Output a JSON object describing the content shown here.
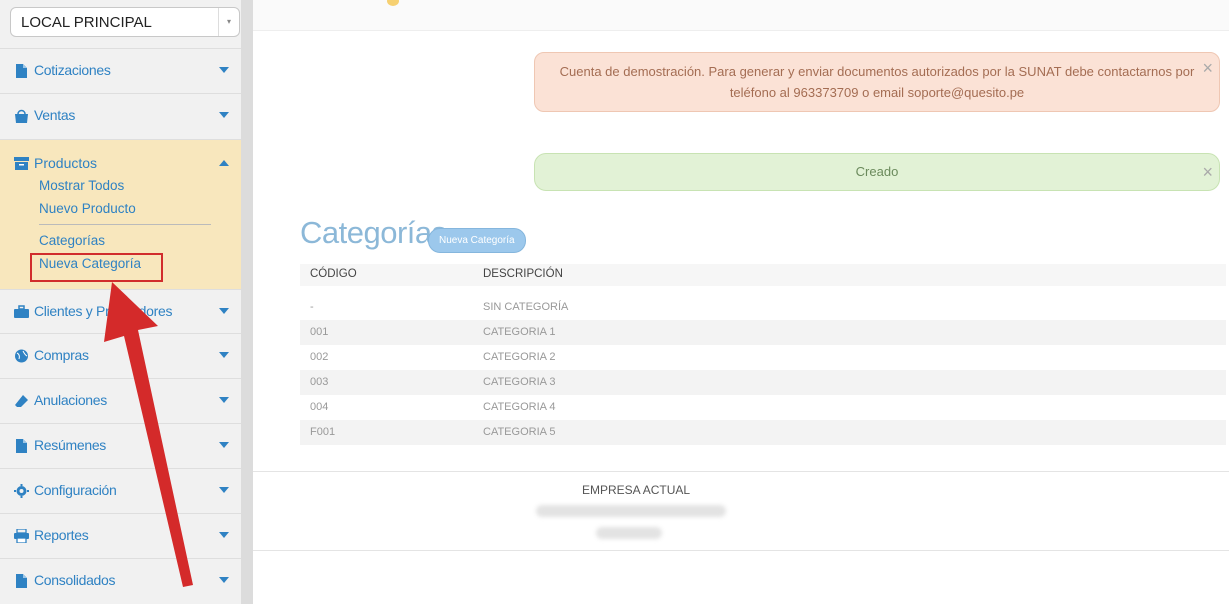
{
  "location_select": {
    "value": "LOCAL PRINCIPAL"
  },
  "sidebar": {
    "items": [
      {
        "label": "Cotizaciones",
        "icon": "file-icon"
      },
      {
        "label": "Ventas",
        "icon": "shopping-bag-icon"
      },
      {
        "label": "Productos",
        "icon": "archive-icon"
      },
      {
        "label": "Clientes y Proveedores",
        "icon": "briefcase-icon"
      },
      {
        "label": "Compras",
        "icon": "globe-icon"
      },
      {
        "label": "Anulaciones",
        "icon": "eraser-icon"
      },
      {
        "label": "Resúmenes",
        "icon": "file-icon"
      },
      {
        "label": "Configuración",
        "icon": "gear-icon"
      },
      {
        "label": "Reportes",
        "icon": "print-icon"
      },
      {
        "label": "Consolidados",
        "icon": "file-icon"
      }
    ],
    "productos_sub": [
      "Mostrar Todos",
      "Nuevo Producto",
      "Categorías",
      "Nueva Categoría"
    ]
  },
  "alerts": {
    "warning": "Cuenta de demostración. Para generar y enviar documentos autorizados por la SUNAT debe contactarnos por teléfono al 963373709 o email soporte@quesito.pe",
    "success": "Creado",
    "close_glyph": "×"
  },
  "main": {
    "title": "Categorías",
    "new_button": "Nueva Categoría",
    "columns": [
      "CÓDIGO",
      "DESCRIPCIÓN"
    ],
    "rows": [
      {
        "code": "-",
        "desc": "SIN CATEGORÍA"
      },
      {
        "code": "001",
        "desc": "CATEGORIA 1"
      },
      {
        "code": "002",
        "desc": "CATEGORIA 2"
      },
      {
        "code": "003",
        "desc": "CATEGORIA 3"
      },
      {
        "code": "004",
        "desc": "CATEGORIA 4"
      },
      {
        "code": "F001",
        "desc": "CATEGORIA 5"
      }
    ]
  },
  "footer": {
    "empresa_title": "EMPRESA ACTUAL"
  },
  "colors": {
    "accent": "#2f82c3",
    "highlight": "#d12d2d",
    "open_menu_bg": "#f8e7bd"
  }
}
